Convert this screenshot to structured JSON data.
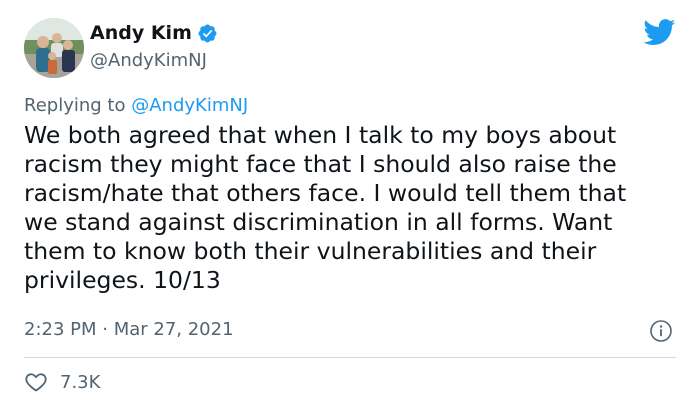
{
  "author": {
    "display_name": "Andy Kim",
    "handle": "@AndyKimNJ",
    "verified": true,
    "avatar_icon": "avatar-photo"
  },
  "reply": {
    "prefix": "Replying to",
    "mention": "@AndyKimNJ"
  },
  "tweet": {
    "lines": [
      "We both agreed that when I talk to my boys about",
      "racism they might face that I should also raise the",
      "racism/hate that others face. I would tell them that",
      "we stand against discrimination in all forms. Want",
      "them to know both their vulnerabilities and their",
      "privileges. 10/13"
    ]
  },
  "meta": {
    "timestamp": "2:23 PM · Mar 27, 2021"
  },
  "engagement": {
    "likes": "7.3K"
  },
  "colors": {
    "brand": "#1d9bf0",
    "text": "#0f1419",
    "secondary": "#536471",
    "divider": "#cfd9de"
  },
  "icons": {
    "logo": "twitter-bird-icon",
    "verified": "verified-badge-icon",
    "info": "info-icon",
    "like": "heart-icon"
  }
}
